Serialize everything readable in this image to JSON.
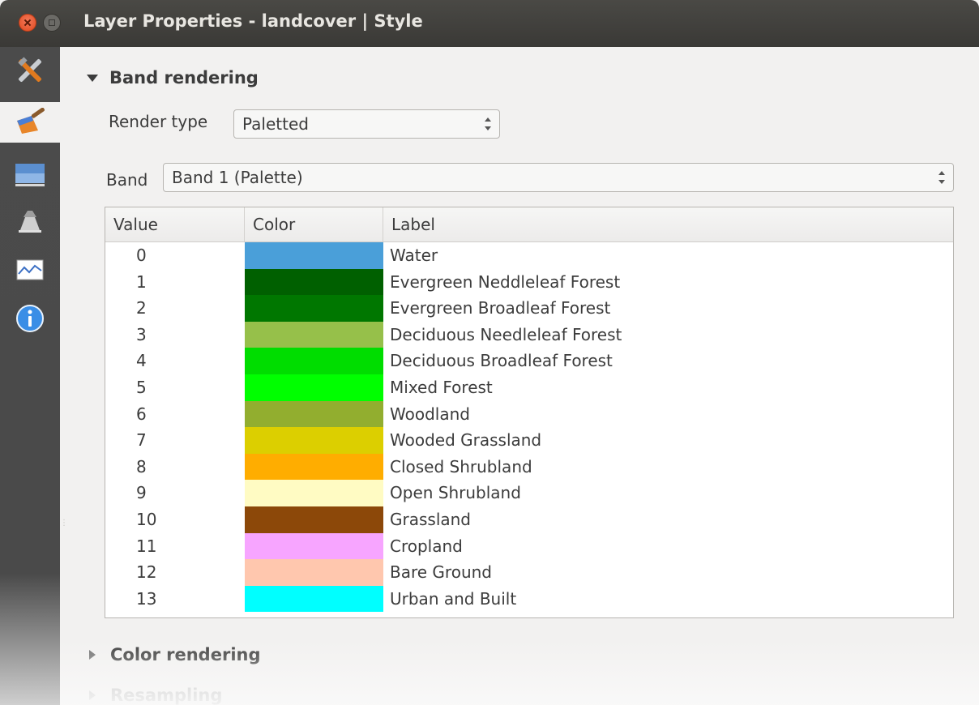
{
  "window": {
    "title": "Layer Properties - landcover | Style"
  },
  "sidebar": {
    "items": [
      {
        "icon": "general-tools-icon",
        "selected": false
      },
      {
        "icon": "style-brush-icon",
        "selected": true
      },
      {
        "icon": "transparency-icon",
        "selected": false
      },
      {
        "icon": "pyramids-icon",
        "selected": false
      },
      {
        "icon": "histogram-icon",
        "selected": false
      },
      {
        "icon": "info-icon",
        "selected": false
      }
    ]
  },
  "band_rendering": {
    "header": "Band rendering",
    "render_type_label": "Render type",
    "render_type_value": "Paletted",
    "band_label": "Band",
    "band_value": "Band 1 (Palette)"
  },
  "table": {
    "headers": [
      "Value",
      "Color",
      "Label"
    ],
    "rows": [
      {
        "value": "0",
        "color": "#4a9fd9",
        "label": "Water"
      },
      {
        "value": "1",
        "color": "#006000",
        "label": "Evergreen Neddleleaf Forest"
      },
      {
        "value": "2",
        "color": "#007700",
        "label": "Evergreen Broadleaf Forest"
      },
      {
        "value": "3",
        "color": "#96c04a",
        "label": "Deciduous Needleleaf Forest"
      },
      {
        "value": "4",
        "color": "#00dd00",
        "label": "Deciduous Broadleaf Forest"
      },
      {
        "value": "5",
        "color": "#00ff00",
        "label": "Mixed Forest"
      },
      {
        "value": "6",
        "color": "#92ae2f",
        "label": "Woodland"
      },
      {
        "value": "7",
        "color": "#dccf00",
        "label": "Wooded Grassland"
      },
      {
        "value": "8",
        "color": "#ffad00",
        "label": "Closed Shrubland"
      },
      {
        "value": "9",
        "color": "#fffbc3",
        "label": "Open Shrubland"
      },
      {
        "value": "10",
        "color": "#8c4809",
        "label": "Grassland"
      },
      {
        "value": "11",
        "color": "#f7a5ff",
        "label": "Cropland"
      },
      {
        "value": "12",
        "color": "#ffc7ae",
        "label": "Bare Ground"
      },
      {
        "value": "13",
        "color": "#00ffff",
        "label": "Urban and Built"
      }
    ]
  },
  "sections": {
    "color_rendering": "Color rendering",
    "resampling": "Resampling"
  }
}
